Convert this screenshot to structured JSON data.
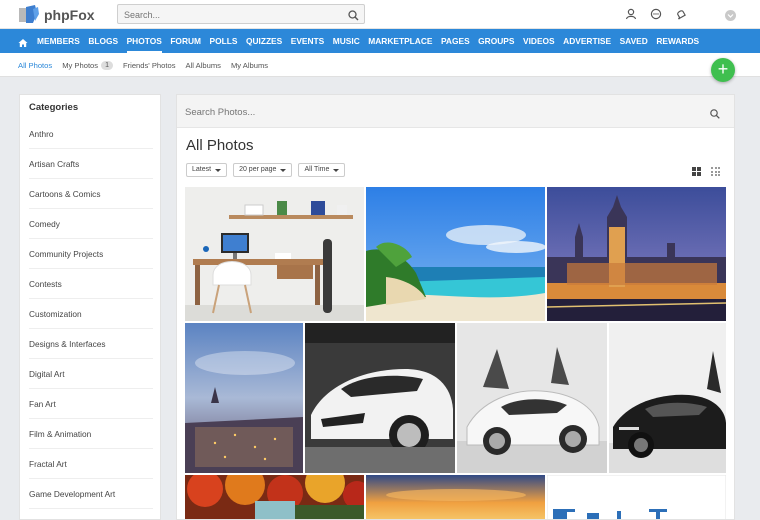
{
  "app": {
    "logo_text": "phpFox"
  },
  "header": {
    "search_placeholder": "Search..."
  },
  "nav": {
    "items": [
      {
        "label": "MEMBERS",
        "name": "nav-item-members"
      },
      {
        "label": "BLOGS",
        "name": "nav-item-blogs"
      },
      {
        "label": "PHOTOS",
        "name": "nav-item-photos",
        "active": true
      },
      {
        "label": "FORUM",
        "name": "nav-item-forum"
      },
      {
        "label": "POLLS",
        "name": "nav-item-polls"
      },
      {
        "label": "QUIZZES",
        "name": "nav-item-quizzes"
      },
      {
        "label": "EVENTS",
        "name": "nav-item-events"
      },
      {
        "label": "MUSIC",
        "name": "nav-item-music"
      },
      {
        "label": "MARKETPLACE",
        "name": "nav-item-marketplace"
      },
      {
        "label": "PAGES",
        "name": "nav-item-pages"
      },
      {
        "label": "GROUPS",
        "name": "nav-item-groups"
      },
      {
        "label": "VIDEOS",
        "name": "nav-item-videos"
      },
      {
        "label": "ADVERTISE",
        "name": "nav-item-advertise"
      },
      {
        "label": "SAVED",
        "name": "nav-item-saved"
      },
      {
        "label": "REWARDS",
        "name": "nav-item-rewards"
      }
    ]
  },
  "subtabs": {
    "all_photos": "All Photos",
    "my_photos": "My Photos",
    "my_photos_count": "1",
    "friends_photos": "Friends' Photos",
    "all_albums": "All Albums",
    "my_albums": "My Albums"
  },
  "fab": {
    "label": "+"
  },
  "sidebar": {
    "title": "Categories",
    "items": [
      "Anthro",
      "Artisan Crafts",
      "Cartoons & Comics",
      "Comedy",
      "Community Projects",
      "Contests",
      "Customization",
      "Designs & Interfaces",
      "Digital Art",
      "Fan Art",
      "Film & Animation",
      "Fractal Art",
      "Game Development Art"
    ]
  },
  "main": {
    "search_placeholder": "Search Photos...",
    "title": "All Photos",
    "filters": {
      "sort": "Latest",
      "per_page": "20 per page",
      "when": "All Time"
    }
  },
  "photos": [
    {
      "name": "photo-desk-workspace"
    },
    {
      "name": "photo-tropical-beach"
    },
    {
      "name": "photo-westminster-night"
    },
    {
      "name": "photo-city-skyline"
    },
    {
      "name": "photo-white-lamborghini-front"
    },
    {
      "name": "photo-white-lamborghini-doors-up"
    },
    {
      "name": "photo-black-lamborghini"
    },
    {
      "name": "photo-autumn-trees"
    },
    {
      "name": "photo-sunset-sky"
    },
    {
      "name": "photo-text-graphic"
    }
  ],
  "colors": {
    "brand_blue": "#2c88d9",
    "fab_green": "#3fbf4f"
  },
  "icons": {
    "search": "search-icon",
    "home": "home-icon",
    "friends": "friends-icon",
    "messages": "chat-icon",
    "notifications": "bell-icon",
    "profile": "avatar"
  }
}
